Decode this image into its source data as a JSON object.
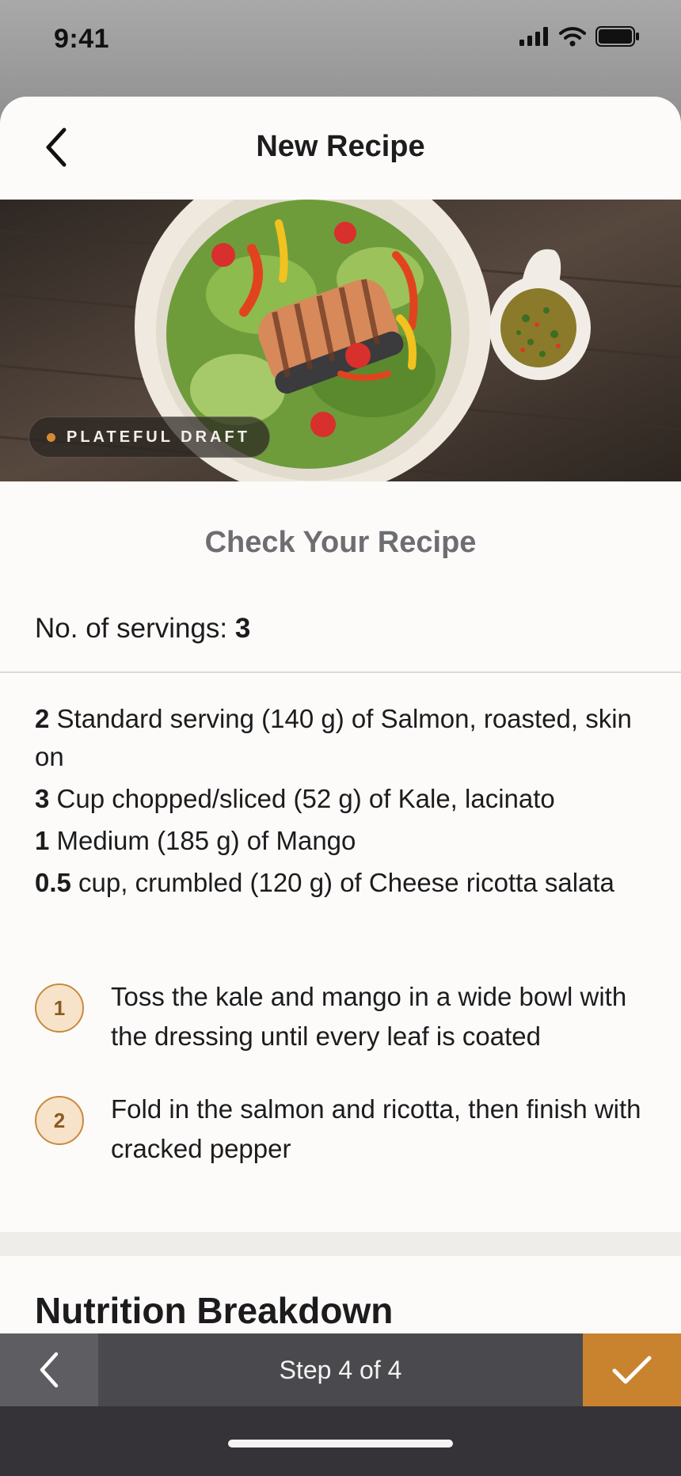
{
  "status_bar": {
    "time": "9:41"
  },
  "nav": {
    "title": "New Recipe"
  },
  "hero": {
    "badge": "PLATEFUL DRAFT"
  },
  "review": {
    "title": "Check Your Recipe",
    "servings_label": "No. of servings: ",
    "servings_value": "3"
  },
  "ingredients": [
    {
      "qty": "2",
      "text": " Standard serving (140 g) of Salmon, roasted, skin on"
    },
    {
      "qty": "3",
      "text": " Cup chopped/sliced (52 g) of Kale, lacinato"
    },
    {
      "qty": "1",
      "text": " Medium (185 g) of Mango"
    },
    {
      "qty": "0.5",
      "text": " cup, crumbled (120 g) of Cheese ricotta salata"
    }
  ],
  "steps": [
    {
      "num": "1",
      "text": "Toss the kale and mango in a wide bowl with the dressing until every leaf is coated"
    },
    {
      "num": "2",
      "text": "Fold in the salmon and ricotta, then finish with cracked pepper"
    }
  ],
  "nutrition": {
    "title": "Nutrition Breakdown"
  },
  "bottom_bar": {
    "step_label": "Step 4 of 4"
  },
  "colors": {
    "accent": "#c9832e",
    "step_circle_bg": "#f7e3c9",
    "bottom_bar": "#4a494e"
  },
  "icons": {
    "nav_back": "chevron-left-icon",
    "bar_back": "chevron-left-icon",
    "bar_done": "checkmark-icon",
    "signal": "cellular-signal-icon",
    "wifi": "wifi-icon",
    "battery": "battery-icon"
  }
}
